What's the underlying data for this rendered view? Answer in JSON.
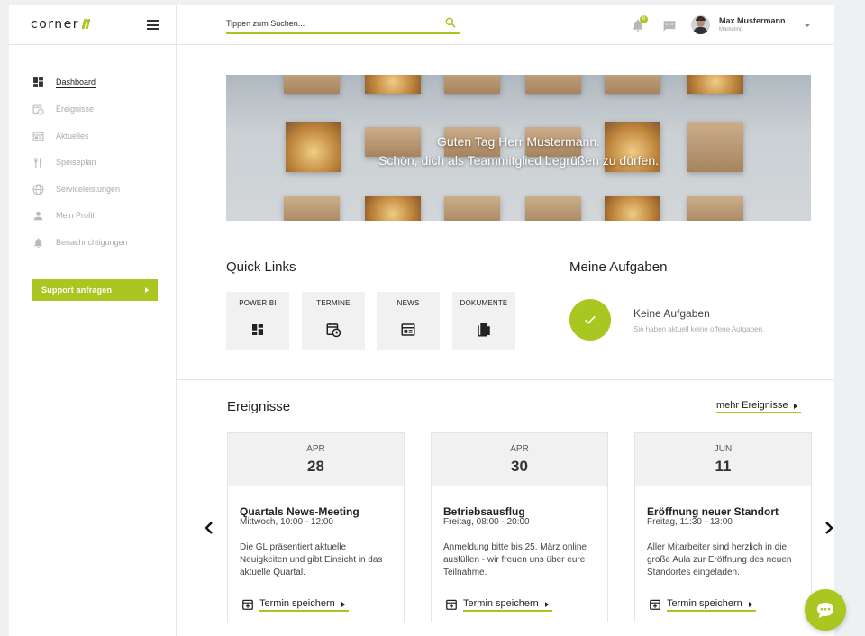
{
  "app": {
    "logo": "corner"
  },
  "search": {
    "placeholder": "Tippen zum Suchen..."
  },
  "notifications": {
    "count": "8"
  },
  "user": {
    "name": "Max Mustermann",
    "role": "Marketing"
  },
  "sidebar": {
    "items": [
      {
        "label": "Dashboard",
        "icon": "dashboard-icon",
        "active": true
      },
      {
        "label": "Ereignisse",
        "icon": "calendar-clock-icon"
      },
      {
        "label": "Aktuelles",
        "icon": "news-icon"
      },
      {
        "label": "Speiseplan",
        "icon": "cutlery-icon"
      },
      {
        "label": "Serviceleistungen",
        "icon": "globe-icon"
      },
      {
        "label": "Mein Profil",
        "icon": "person-icon"
      },
      {
        "label": "Benachrichtigungen",
        "icon": "bell-icon"
      }
    ],
    "support_button": "Support anfragen"
  },
  "hero": {
    "line1": "Guten Tag Herr Mustermann.",
    "line2": "Schön, dich als Teammitglied begrüßen zu dürfen."
  },
  "quick_links": {
    "title": "Quick Links",
    "tiles": [
      {
        "label": "POWER BI",
        "icon": "dashboard-icon"
      },
      {
        "label": "TERMINE",
        "icon": "calendar-clock-icon"
      },
      {
        "label": "NEWS",
        "icon": "news-icon"
      },
      {
        "label": "DOKUMENTE",
        "icon": "document-icon"
      }
    ]
  },
  "tasks": {
    "title": "Meine Aufgaben",
    "empty_title": "Keine Aufgaben",
    "empty_subtitle": "Sie haben aktuell keine offene Aufgaben."
  },
  "events": {
    "title": "Ereignisse",
    "more_link": "mehr Ereignisse",
    "cards": [
      {
        "month": "APR",
        "day": "28",
        "title": "Quartals News-Meeting",
        "time": "Mittwoch, 10:00 - 12:00",
        "description": "Die GL präsentiert aktuelle Neuigkeiten und gibt Einsicht in das aktuelle Quartal.",
        "save_label": "Termin speichern"
      },
      {
        "month": "APR",
        "day": "30",
        "title": "Betriebsausflug",
        "time": "Freitag, 08:00 - 20:00",
        "description": "Anmeldung bitte bis 25. März online ausfüllen - wir freuen uns über eure Teilnahme.",
        "save_label": "Termin speichern"
      },
      {
        "month": "JUN",
        "day": "11",
        "title": "Eröffnung neuer Standort",
        "time": "Freitag, 11:30 - 13:00",
        "description": "Aller Mitarbeiter sind herzlich in die große Aula zur Eröffnung des neuen Standortes eingeladen.",
        "save_label": "Termin speichern"
      }
    ]
  },
  "colors": {
    "accent": "#a9c720",
    "tile_bg": "#f1f1f1",
    "muted_text": "#aaaaaa"
  }
}
